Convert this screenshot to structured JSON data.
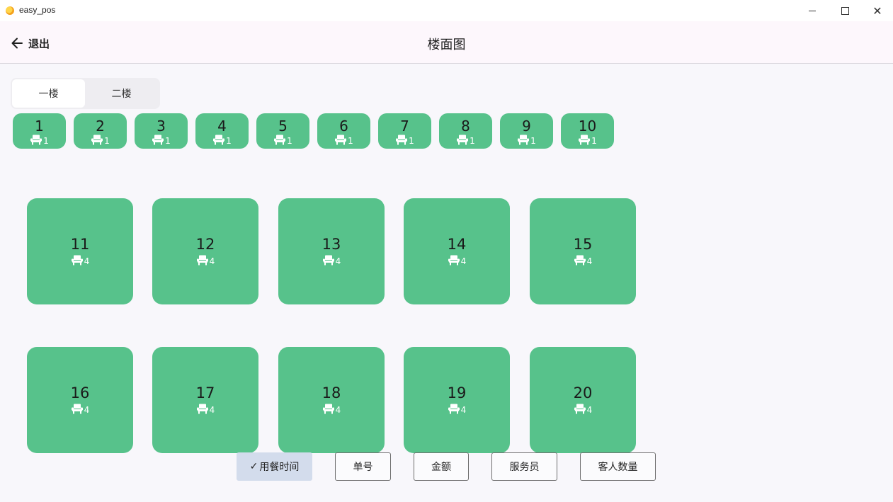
{
  "window": {
    "title": "easy_pos",
    "close_glyph": "✕"
  },
  "header": {
    "back_label": "退出",
    "title": "楼面图"
  },
  "floors": [
    {
      "label": "一楼",
      "active": true
    },
    {
      "label": "二楼",
      "active": false
    }
  ],
  "small_tables": [
    {
      "number": "1",
      "seats": "1"
    },
    {
      "number": "2",
      "seats": "1"
    },
    {
      "number": "3",
      "seats": "1"
    },
    {
      "number": "4",
      "seats": "1"
    },
    {
      "number": "5",
      "seats": "1"
    },
    {
      "number": "6",
      "seats": "1"
    },
    {
      "number": "7",
      "seats": "1"
    },
    {
      "number": "8",
      "seats": "1"
    },
    {
      "number": "9",
      "seats": "1"
    },
    {
      "number": "10",
      "seats": "1"
    }
  ],
  "big_tables": [
    {
      "number": "11",
      "seats": "4"
    },
    {
      "number": "12",
      "seats": "4"
    },
    {
      "number": "13",
      "seats": "4"
    },
    {
      "number": "14",
      "seats": "4"
    },
    {
      "number": "15",
      "seats": "4"
    },
    {
      "number": "16",
      "seats": "4"
    },
    {
      "number": "17",
      "seats": "4"
    },
    {
      "number": "18",
      "seats": "4"
    },
    {
      "number": "19",
      "seats": "4"
    },
    {
      "number": "20",
      "seats": "4"
    }
  ],
  "sort_options": [
    {
      "label": "用餐时间",
      "selected": true
    },
    {
      "label": "单号",
      "selected": false
    },
    {
      "label": "金额",
      "selected": false
    },
    {
      "label": "服务员",
      "selected": false
    },
    {
      "label": "客人数量",
      "selected": false
    }
  ],
  "icons": {
    "back": "arrow-left-icon",
    "seat": "chair-icon",
    "check": "check-icon"
  },
  "colors": {
    "table": "#57c28b",
    "selected_sort": "#d3dcec",
    "header_bg": "#fdf7fc"
  }
}
